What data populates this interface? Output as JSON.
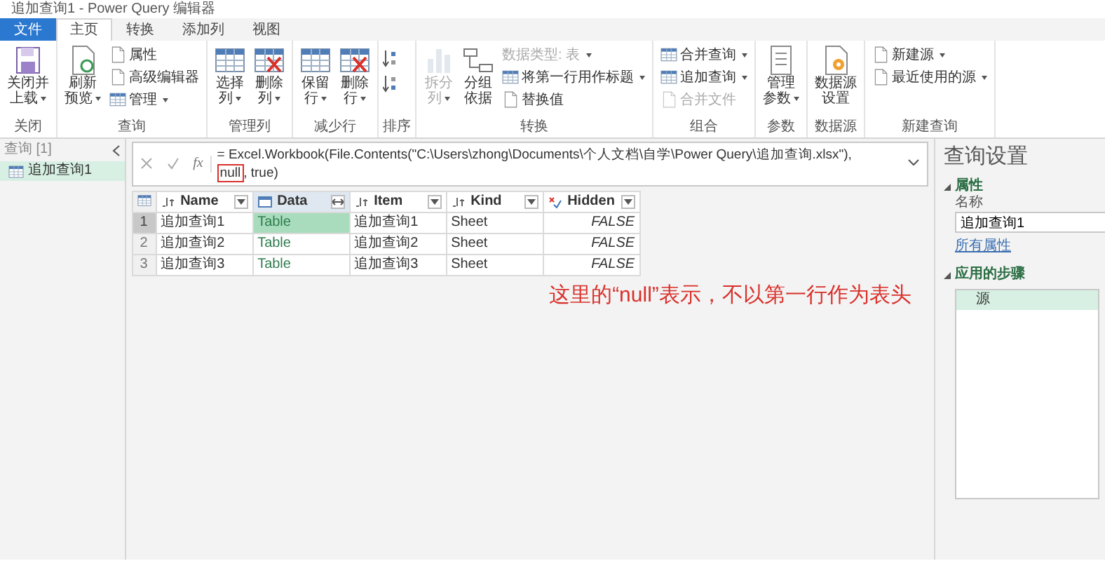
{
  "window": {
    "title": "追加查询1 - Power Query 编辑器"
  },
  "tabs": [
    {
      "label": "文件",
      "kind": "file",
      "selected": false
    },
    {
      "label": "主页",
      "kind": "tab",
      "selected": true
    },
    {
      "label": "转换",
      "kind": "tab",
      "selected": false
    },
    {
      "label": "添加列",
      "kind": "tab",
      "selected": false
    },
    {
      "label": "视图",
      "kind": "tab",
      "selected": false
    }
  ],
  "ribbon": {
    "groups": [
      {
        "label": "关闭",
        "columns": [
          {
            "kind": "large",
            "lines": [
              "关闭并",
              "上载"
            ],
            "dropdown": true,
            "disabled": false
          }
        ]
      },
      {
        "label": "查询",
        "columns": [
          {
            "kind": "large",
            "lines": [
              "刷新",
              "预览"
            ],
            "dropdown": true,
            "disabled": false
          },
          {
            "kind": "stack",
            "items": [
              {
                "label": "属性",
                "dropdown": false,
                "disabled": false
              },
              {
                "label": "高级编辑器",
                "dropdown": false,
                "disabled": false
              },
              {
                "label": "管理",
                "dropdown": true,
                "disabled": false
              }
            ]
          }
        ]
      },
      {
        "label": "管理列",
        "columns": [
          {
            "kind": "large",
            "lines": [
              "选择",
              "列"
            ],
            "dropdown": true,
            "disabled": false
          },
          {
            "kind": "large",
            "lines": [
              "删除",
              "列"
            ],
            "dropdown": true,
            "disabled": false
          }
        ]
      },
      {
        "label": "减少行",
        "columns": [
          {
            "kind": "large",
            "lines": [
              "保留",
              "行"
            ],
            "dropdown": true,
            "disabled": false
          },
          {
            "kind": "large",
            "lines": [
              "删除",
              "行"
            ],
            "dropdown": true,
            "disabled": false
          }
        ]
      },
      {
        "label": "排序",
        "columns": [
          {
            "kind": "sort"
          }
        ]
      },
      {
        "label": "转换",
        "columns": [
          {
            "kind": "large",
            "lines": [
              "拆分",
              "列"
            ],
            "dropdown": true,
            "disabled": true
          },
          {
            "kind": "large",
            "lines": [
              "分组",
              "依据"
            ],
            "dropdown": false,
            "disabled": false
          },
          {
            "kind": "stack",
            "items": [
              {
                "label": "数据类型: 表",
                "dropdown": true,
                "disabled": true
              },
              {
                "label": "将第一行用作标题",
                "dropdown": true,
                "disabled": false
              },
              {
                "label": "替换值",
                "dropdown": false,
                "disabled": false
              }
            ]
          }
        ]
      },
      {
        "label": "组合",
        "columns": [
          {
            "kind": "stack",
            "items": [
              {
                "label": "合并查询",
                "dropdown": true,
                "disabled": false
              },
              {
                "label": "追加查询",
                "dropdown": true,
                "disabled": false
              },
              {
                "label": "合并文件",
                "dropdown": false,
                "disabled": true
              }
            ]
          }
        ]
      },
      {
        "label": "参数",
        "columns": [
          {
            "kind": "large",
            "lines": [
              "管理",
              "参数"
            ],
            "dropdown": true,
            "disabled": false
          }
        ]
      },
      {
        "label": "数据源",
        "columns": [
          {
            "kind": "large",
            "lines": [
              "数据源",
              "设置"
            ],
            "dropdown": false,
            "disabled": false
          }
        ]
      },
      {
        "label": "新建查询",
        "columns": [
          {
            "kind": "stack",
            "items": [
              {
                "label": "新建源",
                "dropdown": true,
                "disabled": false
              },
              {
                "label": "最近使用的源",
                "dropdown": true,
                "disabled": false
              }
            ]
          }
        ]
      }
    ]
  },
  "queries_pane": {
    "title": "查询 [1]",
    "items": [
      {
        "label": "追加查询1",
        "selected": true
      }
    ]
  },
  "formula_bar": {
    "fx_label": "fx",
    "before": "= Excel.Workbook(File.Contents(\"C:\\Users\\zhong\\Documents\\个人文档\\自学\\Power Query\\追加查询.xlsx\"),",
    "highlight": "null",
    "after": ", true)"
  },
  "table": {
    "columns": [
      {
        "label": "Name",
        "kind": "text",
        "selected": false
      },
      {
        "label": "Data",
        "kind": "table",
        "selected": true
      },
      {
        "label": "Item",
        "kind": "text",
        "selected": false
      },
      {
        "label": "Kind",
        "kind": "text",
        "selected": false
      },
      {
        "label": "Hidden",
        "kind": "logical",
        "selected": false
      }
    ],
    "rows": [
      {
        "number": "1",
        "selected": true,
        "cells": [
          {
            "text": "追加查询1",
            "selected": false
          },
          {
            "text": "Table",
            "selected": true
          },
          {
            "text": "追加查询1",
            "selected": false
          },
          {
            "text": "Sheet",
            "selected": false
          },
          {
            "text": "FALSE",
            "selected": false
          }
        ]
      },
      {
        "number": "2",
        "selected": false,
        "cells": [
          {
            "text": "追加查询2",
            "selected": false
          },
          {
            "text": "Table",
            "selected": false
          },
          {
            "text": "追加查询2",
            "selected": false
          },
          {
            "text": "Sheet",
            "selected": false
          },
          {
            "text": "FALSE",
            "selected": false
          }
        ]
      },
      {
        "number": "3",
        "selected": false,
        "cells": [
          {
            "text": "追加查询3",
            "selected": false
          },
          {
            "text": "Table",
            "selected": false
          },
          {
            "text": "追加查询3",
            "selected": false
          },
          {
            "text": "Sheet",
            "selected": false
          },
          {
            "text": "FALSE",
            "selected": false
          }
        ]
      }
    ]
  },
  "annotation": {
    "text": "这里的“null”表示，不以第一行作为表头"
  },
  "settings_pane": {
    "title": "查询设置",
    "properties": {
      "title": "属性",
      "expanded": true,
      "name_label": "名称",
      "name_value": "追加查询1",
      "all_properties_link": "所有属性"
    },
    "steps_section": {
      "title": "应用的步骤",
      "expanded": true,
      "steps": [
        {
          "label": "源",
          "selected": true
        }
      ]
    }
  }
}
